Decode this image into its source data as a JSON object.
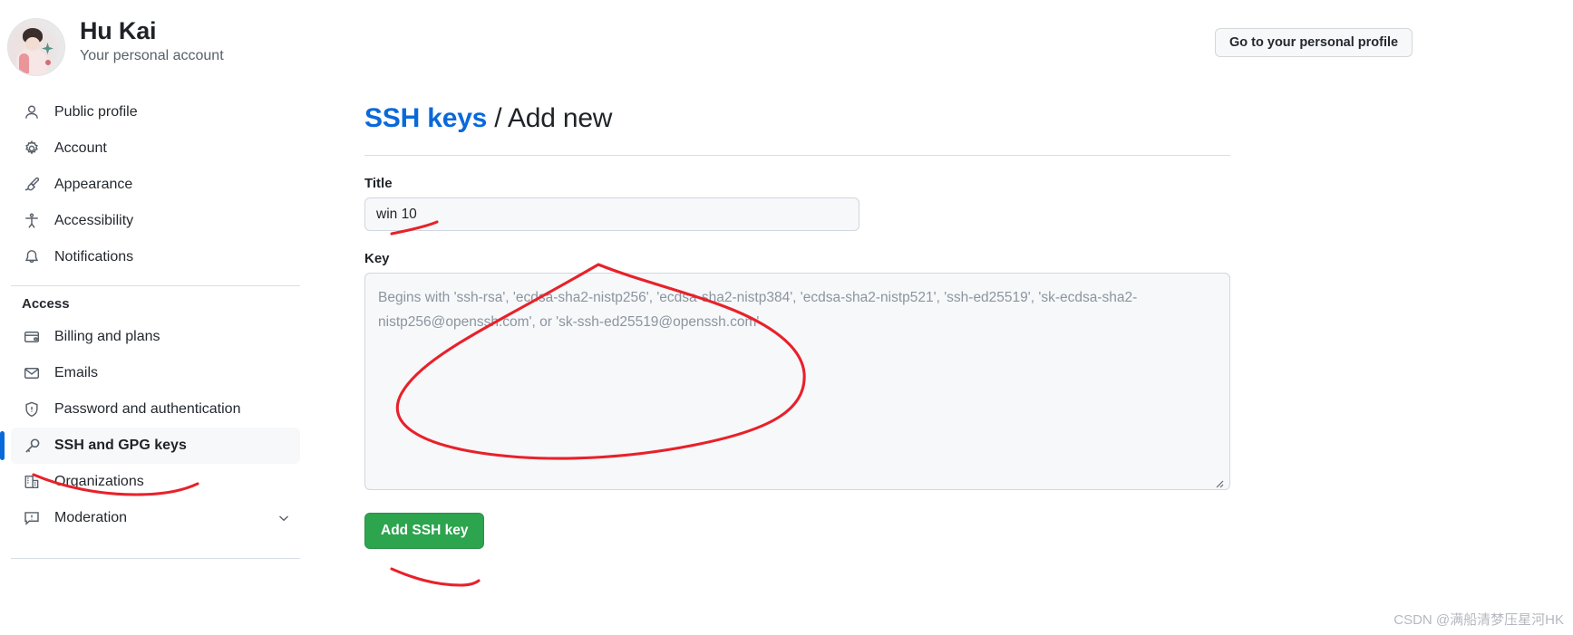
{
  "header": {
    "user_name": "Hu Kai",
    "user_subtitle": "Your personal account",
    "profile_button": "Go to your personal profile",
    "avatar_icon": "user-avatar-photo"
  },
  "sidebar": {
    "items": [
      {
        "label": "Public profile",
        "icon": "person-icon",
        "active": false
      },
      {
        "label": "Account",
        "icon": "gear-icon",
        "active": false
      },
      {
        "label": "Appearance",
        "icon": "paintbrush-icon",
        "active": false
      },
      {
        "label": "Accessibility",
        "icon": "accessibility-icon",
        "active": false
      },
      {
        "label": "Notifications",
        "icon": "bell-icon",
        "active": false
      }
    ],
    "group_title": "Access",
    "access_items": [
      {
        "label": "Billing and plans",
        "icon": "credit-card-icon",
        "active": false
      },
      {
        "label": "Emails",
        "icon": "mail-icon",
        "active": false
      },
      {
        "label": "Password and authentication",
        "icon": "shield-lock-icon",
        "active": false
      },
      {
        "label": "SSH and GPG keys",
        "icon": "key-icon",
        "active": true
      },
      {
        "label": "Organizations",
        "icon": "organization-icon",
        "active": false
      },
      {
        "label": "Moderation",
        "icon": "report-icon",
        "active": false,
        "chevron": "chevron-down-icon"
      }
    ]
  },
  "main": {
    "breadcrumb_link": "SSH keys",
    "breadcrumb_separator": " / ",
    "breadcrumb_current": "Add new",
    "title_label": "Title",
    "title_value": "win 10",
    "title_placeholder": "",
    "key_label": "Key",
    "key_value": "",
    "key_placeholder": "Begins with 'ssh-rsa', 'ecdsa-sha2-nistp256', 'ecdsa-sha2-nistp384', 'ecdsa-sha2-nistp521', 'ssh-ed25519', 'sk-ecdsa-sha2-nistp256@openssh.com', or 'sk-ssh-ed25519@openssh.com'",
    "submit_button": "Add SSH key",
    "resize_icon": "resize-grip-icon"
  },
  "annotations": {
    "color": "#e8212a",
    "marks": [
      "underline-under-ssh-and-gpg-keys",
      "underline-under-title-input",
      "circle-around-key-textarea",
      "underline-under-add-ssh-key-button"
    ]
  },
  "watermark": {
    "text": "CSDN @满船清梦压星河HK",
    "color": "#b4b9bf"
  },
  "colors": {
    "accent_blue": "#0969da",
    "green_button": "#2da44e",
    "annotation_red": "#e8212a",
    "muted_text": "#57606a",
    "field_bg": "#f6f8fa",
    "border": "#d0d7de"
  }
}
